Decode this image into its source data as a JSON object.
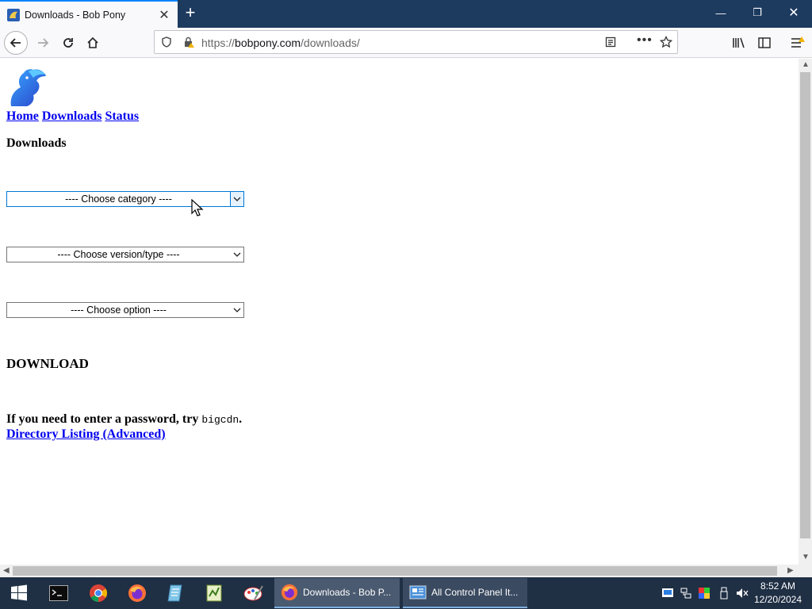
{
  "browser": {
    "tab_title": "Downloads - Bob Pony",
    "url_prefix": "https://",
    "url_domain": "bobpony.com",
    "url_path": "/downloads/"
  },
  "page": {
    "nav_links": [
      "Home",
      "Downloads",
      "Status"
    ],
    "heading": "Downloads",
    "selects": {
      "category": "---- Choose category ----",
      "version": "---- Choose version/type ----",
      "option": "---- Choose option ----"
    },
    "download_heading": "DOWNLOAD",
    "password_text": "If you need to enter a password, try",
    "password_value": "bigcdn",
    "password_end": ".",
    "directory_link": "Directory Listing (Advanced)"
  },
  "taskbar": {
    "tasks": [
      "Downloads - Bob P...",
      "All Control Panel It..."
    ],
    "time": "8:52 AM",
    "date": "12/20/2024"
  },
  "colors": {
    "titlebar": "#1d3a5f",
    "link": "#0000ee",
    "taskbar": "#1f2f44",
    "accent": "#0078d7"
  }
}
